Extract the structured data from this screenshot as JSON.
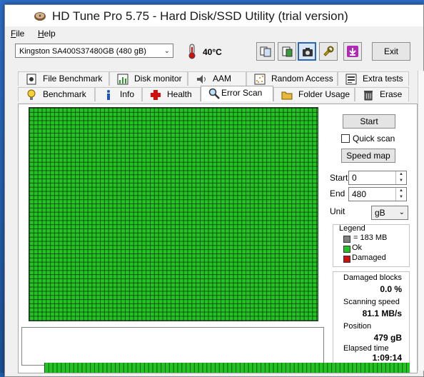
{
  "window": {
    "title": "HD Tune Pro 5.75 - Hard Disk/SSD Utility (trial version)"
  },
  "menu": {
    "file": "File",
    "help": "Help"
  },
  "toolbar": {
    "drive": "Kingston SA400S37480GB (480 gB)",
    "temperature": "40°C",
    "exit_label": "Exit"
  },
  "tabs_top": [
    {
      "label": "File Benchmark",
      "icon": "file-benchmark-icon"
    },
    {
      "label": "Disk monitor",
      "icon": "disk-monitor-icon"
    },
    {
      "label": "AAM",
      "icon": "speaker-icon"
    },
    {
      "label": "Random Access",
      "icon": "random-access-icon"
    },
    {
      "label": "Extra tests",
      "icon": "extra-tests-icon"
    }
  ],
  "tabs_bottom": [
    {
      "label": "Benchmark",
      "icon": "lightbulb-icon"
    },
    {
      "label": "Info",
      "icon": "info-icon"
    },
    {
      "label": "Health",
      "icon": "health-cross-icon"
    },
    {
      "label": "Error Scan",
      "icon": "magnifier-icon",
      "selected": true
    },
    {
      "label": "Folder Usage",
      "icon": "folder-icon"
    },
    {
      "label": "Erase",
      "icon": "trash-icon"
    }
  ],
  "scan": {
    "start_button": "Start",
    "quick_scan_label": "Quick scan",
    "speed_map_button": "Speed map",
    "start_label": "Start",
    "start_value": "0",
    "end_label": "End",
    "end_value": "480",
    "unit_label": "Unit",
    "unit_value": "gB"
  },
  "legend": {
    "title": "Legend",
    "block": "= 183 MB",
    "ok": "Ok",
    "damaged": "Damaged",
    "colors": {
      "block": "#808080",
      "ok": "#22c322",
      "damaged": "#d01010"
    }
  },
  "stats": {
    "damaged_blocks_label": "Damaged blocks",
    "damaged_blocks_value": "0.0 %",
    "scanning_speed_label": "Scanning speed",
    "scanning_speed_value": "81.1 MB/s",
    "position_label": "Position",
    "position_value": "479 gB",
    "elapsed_label": "Elapsed time",
    "elapsed_value": "1:09:14"
  }
}
